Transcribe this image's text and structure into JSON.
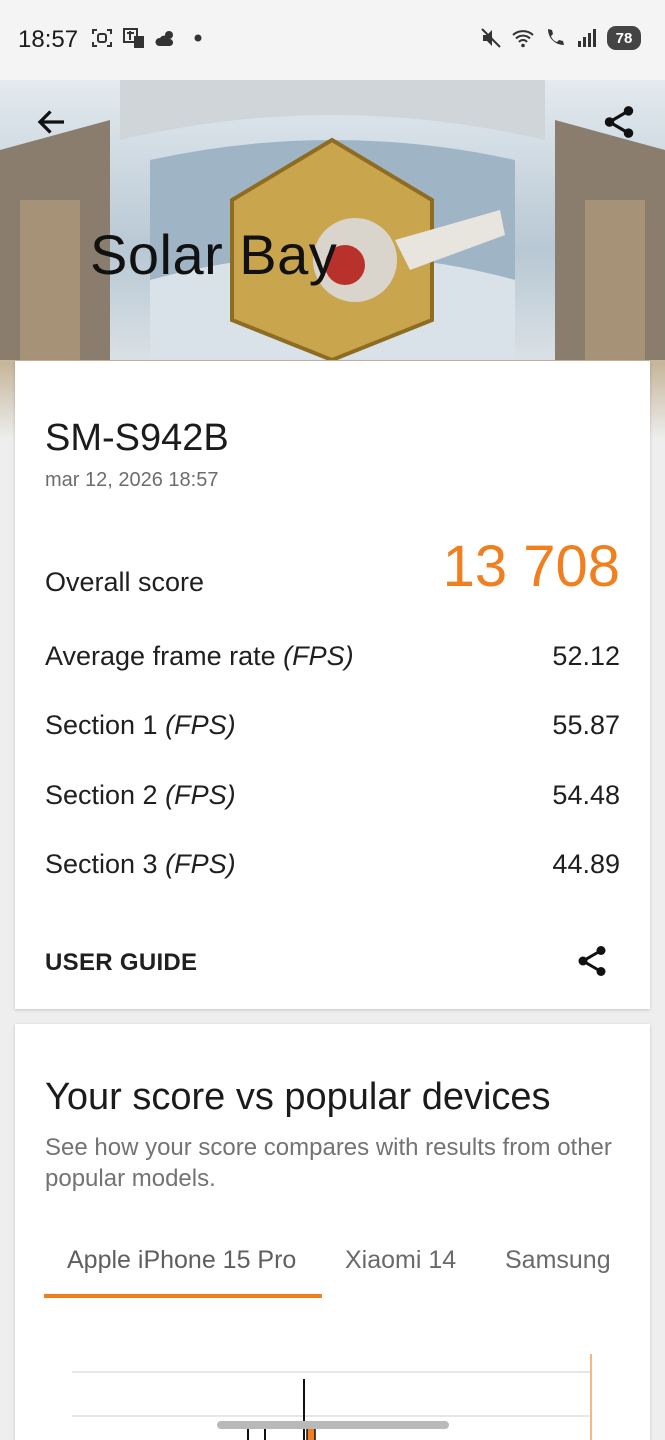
{
  "status_bar": {
    "time": "18:57",
    "battery": "78",
    "left_icons": [
      "screenshot-icon",
      "translate-icon",
      "weather-icon",
      "dot-icon"
    ],
    "right_icons": [
      "mute-icon",
      "wifi-icon",
      "wifi-calling-icon",
      "signal-icon",
      "battery-icon"
    ]
  },
  "header": {
    "title": "Solar Bay",
    "back_icon": "arrow-left-icon",
    "share_icon": "share-icon"
  },
  "result": {
    "device": "SM-S942B",
    "date": "mar 12, 2026 18:57",
    "overall_label": "Overall score",
    "overall_value": "13 708",
    "accent_color": "#f07f1f",
    "metrics": [
      {
        "label": "Average frame rate",
        "unit": "(FPS)",
        "value": "52.12"
      },
      {
        "label": "Section 1",
        "unit": "(FPS)",
        "value": "55.87"
      },
      {
        "label": "Section 2",
        "unit": "(FPS)",
        "value": "54.48"
      },
      {
        "label": "Section 3",
        "unit": "(FPS)",
        "value": "44.89"
      }
    ],
    "user_guide": "USER GUIDE"
  },
  "compare": {
    "title": "Your score vs popular devices",
    "subtitle": "See how your score compares with results from other popular models.",
    "tabs": [
      {
        "label": "Apple iPhone 15 Pro",
        "active": true
      },
      {
        "label": "Xiaomi 14",
        "active": false
      },
      {
        "label": "Samsung",
        "active": false
      }
    ]
  }
}
